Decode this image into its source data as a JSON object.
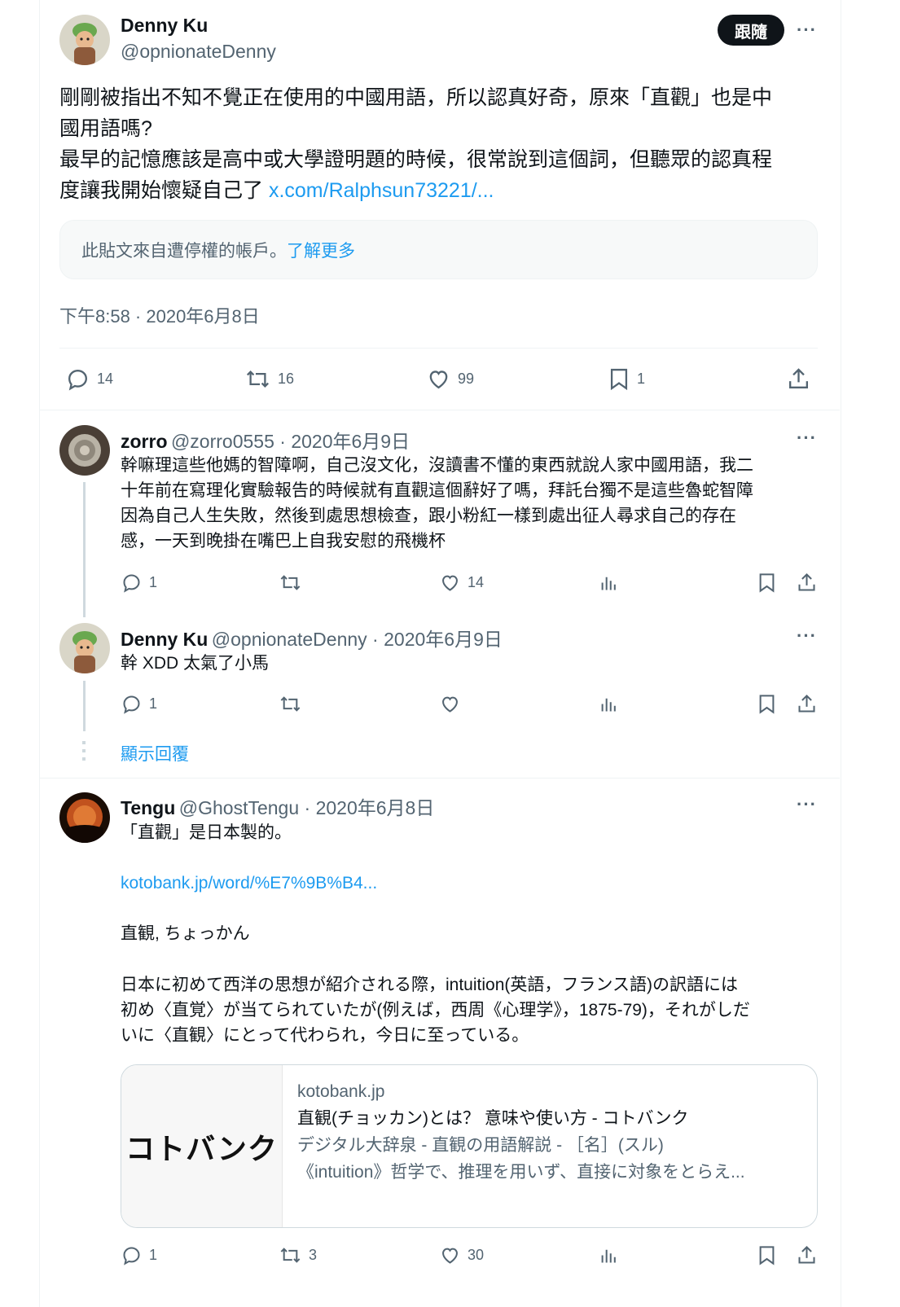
{
  "main_tweet": {
    "author_name": "Denny Ku",
    "author_handle": "@opnionateDenny",
    "follow_label": "跟隨",
    "more_label": "···",
    "text_lines": [
      "剛剛被指出不知不覺正在使用的中國用語，所以認真好奇，原來「直觀」也是中",
      "國用語嗎?",
      "最早的記憶應該是高中或大學證明題的時候，很常說到這個詞，但聽眾的認真程"
    ],
    "last_line_prefix": "度讓我開始懷疑自己了 ",
    "link": "x.com/Ralphsun73221/...",
    "notice_text": "此貼文來自遭停權的帳戶。",
    "notice_link": "了解更多",
    "timestamp": "下午8:58 · 2020年6月8日",
    "stats": {
      "replies": "14",
      "reposts": "16",
      "likes": "99",
      "bookmarks": "1"
    }
  },
  "replies": [
    {
      "author_name": "zorro",
      "author_handle": "@zorro0555",
      "date": " · 2020年6月9日",
      "more_label": "···",
      "text_lines": [
        "幹嘛理這些他媽的智障啊，自己沒文化，沒讀書不懂的東西就說人家中國用語，我二",
        "十年前在寫理化實驗報告的時候就有直觀這個辭好了嗎，拜託台獨不是這些魯蛇智障",
        "因為自己人生失敗，然後到處思想檢查，跟小粉紅一樣到處出征人尋求自己的存在",
        "感，一天到晚掛在嘴巴上自我安慰的飛機杯"
      ],
      "stats": {
        "replies": "1",
        "reposts": "",
        "likes": "14"
      }
    },
    {
      "author_name": "Denny Ku",
      "author_handle": "@opnionateDenny",
      "date": " · 2020年6月9日",
      "more_label": "···",
      "text_lines": [
        "幹 XDD 太氣了小馬"
      ],
      "stats": {
        "replies": "1",
        "reposts": "",
        "likes": ""
      },
      "show_replies": "顯示回覆"
    },
    {
      "author_name": "Tengu",
      "author_handle": "@GhostTengu",
      "date": " · 2020年6月8日",
      "more_label": "···",
      "text_line1": "「直觀」是日本製的。",
      "link": "kotobank.jp/word/%E7%9B%B4...",
      "reading": "直観, ちょっかん",
      "para_lines": [
        "日本に初めて西洋の思想が紹介される際，intuition(英語，フランス語)の訳語には",
        "初め〈直覚〉が当てられていたが(例えば，西周《心理学》，1875-79)，それがしだ",
        "いに〈直観〉にとって代わられ，今日に至っている。"
      ],
      "card": {
        "thumb_text": "コトバンク",
        "domain": "kotobank.jp",
        "title": "直観(チョッカン)とは？ 意味や使い方 - コトバンク",
        "desc_line1": "デジタル大辞泉 - 直観の用語解説 - ［名］(スル)",
        "desc_line2": "《intuition》哲学で、推理を用いず、直接に対象をとらえ..."
      },
      "stats": {
        "replies": "1",
        "reposts": "3",
        "likes": "30"
      }
    }
  ],
  "icons": [
    "reply-icon",
    "repost-icon",
    "like-icon",
    "bookmark-icon",
    "share-icon",
    "views-icon"
  ],
  "colors": {
    "link": "#1d9bf0",
    "secondary": "#536471",
    "text": "#0f1419",
    "follow_bg": "#0f1419"
  }
}
